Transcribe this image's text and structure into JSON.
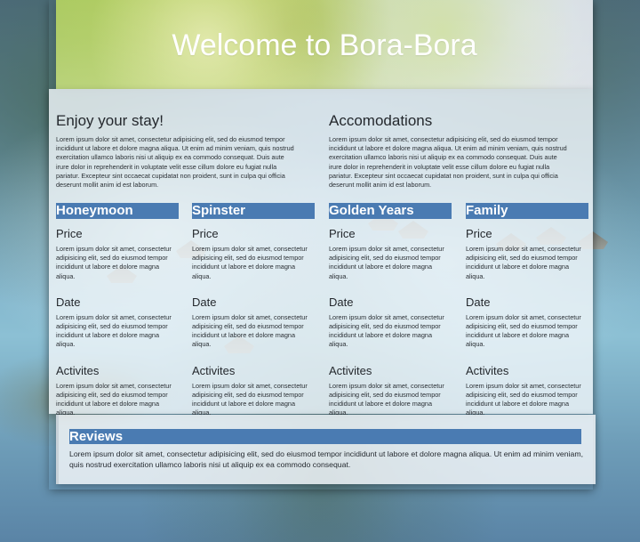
{
  "page": {
    "title": "Welcome to Bora-Bora"
  },
  "intro": {
    "left": {
      "heading": "Enjoy your stay!",
      "text": "Lorem ipsum dolor sit amet, consectetur adipisicing elit, sed do eiusmod tempor incididunt ut labore et dolore magna aliqua. Ut enim ad minim veniam, quis nostrud exercitation ullamco laboris nisi ut aliquip ex ea commodo consequat. Duis aute irure dolor in reprehenderit in voluptate velit esse cillum dolore eu fugiat nulla pariatur. Excepteur sint occaecat cupidatat non proident, sunt in culpa qui officia deserunt mollit anim id est laborum."
    },
    "right": {
      "heading": "Accomodations",
      "text": "Lorem ipsum dolor sit amet, consectetur adipisicing elit, sed do eiusmod tempor incididunt ut labore et dolore magna aliqua. Ut enim ad minim veniam, quis nostrud exercitation ullamco laboris nisi ut aliquip ex ea commodo consequat. Duis aute irure dolor in reprehenderit in voluptate velit esse cillum dolore eu fugiat nulla pariatur. Excepteur sint occaecat cupidatat non proident, sunt in culpa qui officia deserunt mollit anim id est laborum."
    }
  },
  "packages": [
    {
      "title": "Honeymoon",
      "sections": [
        {
          "heading": "Price",
          "text": "Lorem ipsum dolor sit amet, consectetur adipisicing elit, sed do eiusmod tempor incididunt ut labore et dolore magna aliqua."
        },
        {
          "heading": "Date",
          "text": "Lorem ipsum dolor sit amet, consectetur adipisicing elit, sed do eiusmod tempor incididunt ut labore et dolore magna aliqua."
        },
        {
          "heading": "Activites",
          "text": "Lorem ipsum dolor sit amet, consectetur adipisicing elit, sed do eiusmod tempor incididunt ut labore et dolore magna aliqua."
        }
      ]
    },
    {
      "title": "Spinster",
      "sections": [
        {
          "heading": "Price",
          "text": "Lorem ipsum dolor sit amet, consectetur adipisicing elit, sed do eiusmod tempor incididunt ut labore et dolore magna aliqua."
        },
        {
          "heading": "Date",
          "text": "Lorem ipsum dolor sit amet, consectetur adipisicing elit, sed do eiusmod tempor incididunt ut labore et dolore magna aliqua."
        },
        {
          "heading": "Activites",
          "text": "Lorem ipsum dolor sit amet, consectetur adipisicing elit, sed do eiusmod tempor incididunt ut labore et dolore magna aliqua."
        }
      ]
    },
    {
      "title": "Golden Years",
      "sections": [
        {
          "heading": "Price",
          "text": "Lorem ipsum dolor sit amet, consectetur adipisicing elit, sed do eiusmod tempor incididunt ut labore et dolore magna aliqua."
        },
        {
          "heading": "Date",
          "text": "Lorem ipsum dolor sit amet, consectetur adipisicing elit, sed do eiusmod tempor incididunt ut labore et dolore magna aliqua."
        },
        {
          "heading": "Activites",
          "text": "Lorem ipsum dolor sit amet, consectetur adipisicing elit, sed do eiusmod tempor incididunt ut labore et dolore magna aliqua."
        }
      ]
    },
    {
      "title": "Family",
      "sections": [
        {
          "heading": "Price",
          "text": "Lorem ipsum dolor sit amet, consectetur adipisicing elit, sed do eiusmod tempor incididunt ut labore et dolore magna aliqua."
        },
        {
          "heading": "Date",
          "text": "Lorem ipsum dolor sit amet, consectetur adipisicing elit, sed do eiusmod tempor incididunt ut labore et dolore magna aliqua."
        },
        {
          "heading": "Activites",
          "text": "Lorem ipsum dolor sit amet, consectetur adipisicing elit, sed do eiusmod tempor incididunt ut labore et dolore magna aliqua."
        }
      ]
    }
  ],
  "reviews": {
    "title": "Reviews",
    "text": "Lorem ipsum dolor sit amet, consectetur adipisicing elit, sed do eiusmod tempor incididunt ut labore et dolore magna aliqua. Ut enim ad minim veniam, quis nostrud exercitation ullamco laboris nisi ut aliquip ex ea commodo consequat."
  },
  "colors": {
    "accent": "#4a7bb2",
    "panel": "#eff5f9",
    "text": "#24282d"
  }
}
